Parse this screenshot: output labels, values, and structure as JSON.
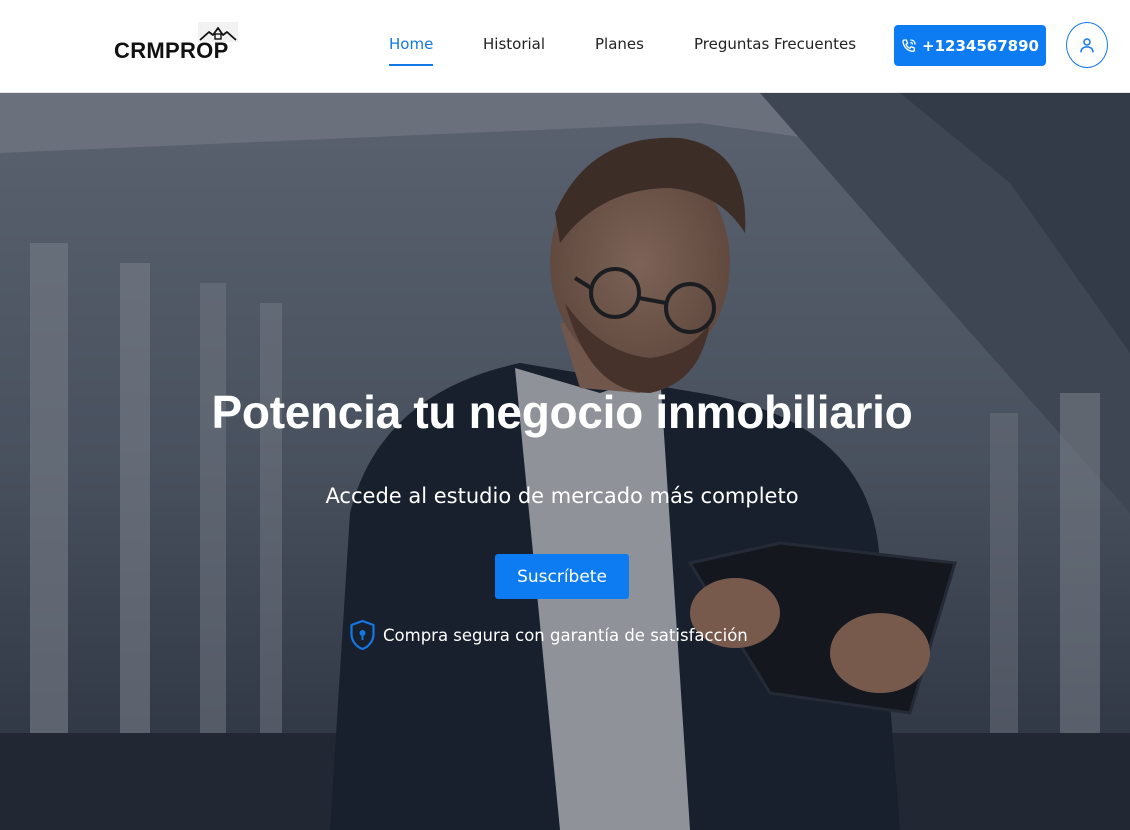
{
  "brand": {
    "name": "CRMPROP",
    "accent_color": "#0d7cf2"
  },
  "nav": {
    "items": [
      {
        "label": "Home",
        "active": true
      },
      {
        "label": "Historial",
        "active": false
      },
      {
        "label": "Planes",
        "active": false
      },
      {
        "label": "Preguntas Frecuentes",
        "active": false
      }
    ],
    "phone_button": {
      "label": "+1234567890",
      "icon": "phone-icon"
    },
    "user_button": {
      "icon": "user-icon"
    }
  },
  "hero": {
    "title": "Potencia tu negocio inmobiliario",
    "subtitle": "Accede al estudio de mercado más completo",
    "cta_label": "Suscríbete",
    "guarantee_text": "Compra segura con garantía de satisfacción",
    "guarantee_icon": "shield-lock-icon",
    "background_image": "man-with-tablet-photo"
  }
}
